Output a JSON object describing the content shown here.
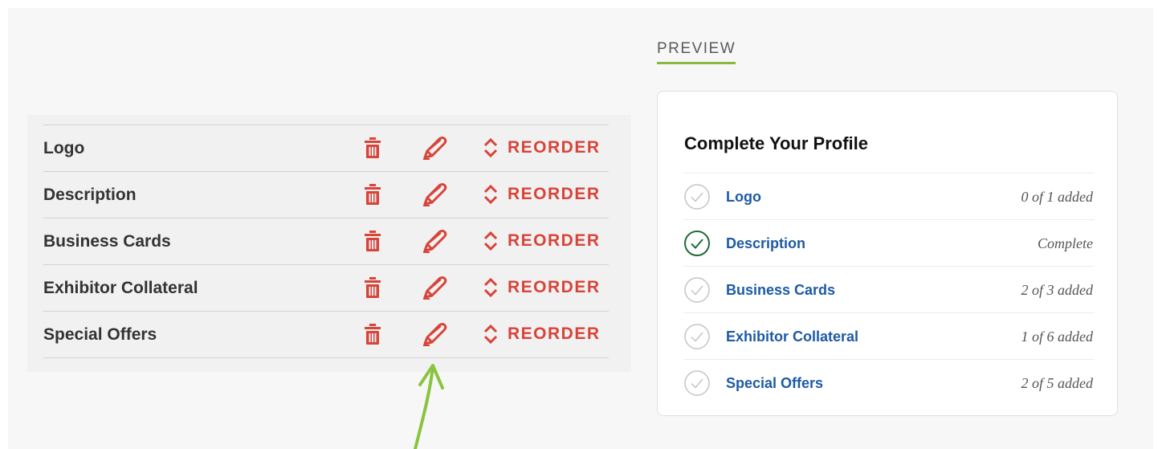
{
  "sections": {
    "reorder_label": "REORDER",
    "rows": [
      {
        "label": "Logo"
      },
      {
        "label": "Description"
      },
      {
        "label": "Business Cards"
      },
      {
        "label": "Exhibitor Collateral"
      },
      {
        "label": "Special Offers"
      }
    ]
  },
  "preview": {
    "heading": "PREVIEW",
    "card_title": "Complete Your Profile",
    "items": [
      {
        "label": "Logo",
        "status": "0 of 1 added",
        "complete": false
      },
      {
        "label": "Description",
        "status": "Complete",
        "complete": true
      },
      {
        "label": "Business Cards",
        "status": "2 of 3 added",
        "complete": false
      },
      {
        "label": "Exhibitor Collateral",
        "status": "1 of 6 added",
        "complete": false
      },
      {
        "label": "Special Offers",
        "status": "2 of 5 added",
        "complete": false
      }
    ]
  },
  "colors": {
    "action_red": "#d7443a",
    "link_blue": "#1d5aa5",
    "complete_green": "#1d6b3a",
    "incomplete_gray": "#c4c4c4",
    "accent_green": "#8ab83f"
  },
  "icons": {
    "delete": "trash-icon",
    "edit": "pencil-icon",
    "reorder": "chevron-up-down-icon",
    "check": "check-circle-icon",
    "annotation": "arrow-up-icon"
  }
}
